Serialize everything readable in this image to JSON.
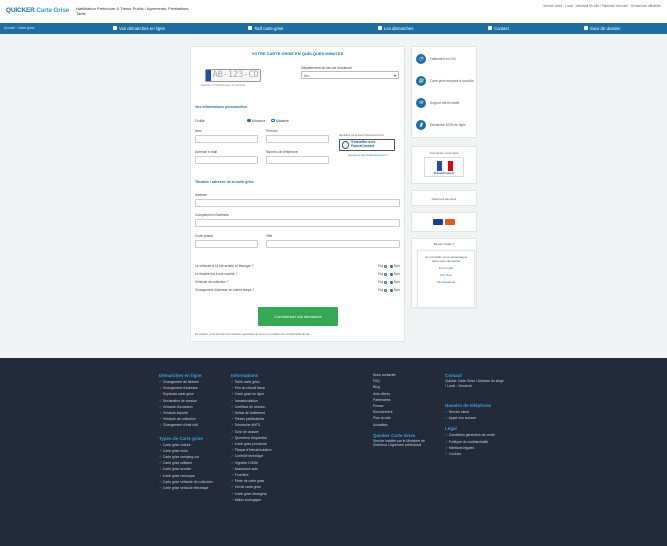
{
  "header": {
    "logo_main": "QUICKER",
    "logo_accent": "Carte Grise",
    "tagline": "Habilitation Préfecture & Trésor Public / Agréments, Prestations, Tarifs",
    "topright": "Service client · Lundi - Vendredi 9h-18h / Paiement sécurisé · Démarches officielles"
  },
  "nav": {
    "home": "Accueil · Carte grise",
    "items": [
      "Vos démarches en ligne",
      "Tarif carte grise",
      "Les démarches",
      "Contact",
      "Suivi de dossier"
    ]
  },
  "form": {
    "title": "VOTRE CARTE GRISE EN QUELQUES MINUTES",
    "plate_text": "AB-123-CD",
    "plate_hint": "Saisissez l'immatriculation du véhicule",
    "dept_label": "Département du lieu de résidence",
    "dept_value": "Ain",
    "section1": "Vos informations personnelles",
    "civility_label": "Civilité",
    "radio_options": [
      "Monsieur",
      "Madame"
    ],
    "nom_label": "Nom",
    "prenom_label": "Prénom",
    "email_label": "Adresse e-mail",
    "phone_label": "Numéro de téléphone",
    "fc_caption": "Identifiez-vous avec FranceConnect",
    "fc_button": "S'identifier avec FranceConnect",
    "fc_link": "Qu'est-ce que FranceConnect ?",
    "section2": "Titulaire / adresse de la carte grise",
    "adresse_label": "Adresse",
    "complement_label": "Complément d'adresse",
    "cp_label": "Code postal",
    "ville_label": "Ville",
    "questions": [
      "Le véhicule a-t-il été acheté à l'étranger ?",
      "Le titulaire est-il une société ?",
      "Véhicule de collection ?",
      "Changement d'adresse en même temps ?"
    ],
    "yes_label": "Oui",
    "no_label": "Non",
    "submit": "Commencer ma démarche",
    "legal": "En validant, vous acceptez les conditions générales de vente et la politique de confidentialité du site."
  },
  "sidebar": {
    "rows": [
      {
        "icon": "clock-icon",
        "glyph": "◷",
        "label": "Traitement en 24h"
      },
      {
        "icon": "document-icon",
        "glyph": "▤",
        "label": "Carte grise envoyée à domicile"
      },
      {
        "icon": "chat-icon",
        "glyph": "✉",
        "label": "Support client réactif"
      },
      {
        "icon": "bookmark-icon",
        "glyph": "▮",
        "label": "Démarche 100% en ligne"
      }
    ],
    "fc_title": "Connectez-vous avec",
    "fc_name": "FranceConnect",
    "secure_label": "Paiement sécurisé",
    "help_title": "Besoin d'aide ?",
    "help_text": "Un conseiller vous accompagne dans votre démarche",
    "help_options": [
      "Par e-mail",
      "Par chat",
      "Par téléphone"
    ]
  },
  "footer": {
    "col1_title": "Démarches en ligne",
    "col1_items": [
      "Changement de titulaire",
      "Changement d'adresse",
      "Duplicata carte grise",
      "Déclaration de cession",
      "Véhicule d'occasion",
      "Véhicule importé",
      "Véhicule de collection",
      "Changement d'état civil"
    ],
    "col1b_title": "Types de Carte grise",
    "col1b_items": [
      "Carte grise voiture",
      "Carte grise moto",
      "Carte grise camping-car",
      "Carte grise utilitaire",
      "Carte grise scooter",
      "Carte grise remorque",
      "Carte grise véhicule de collection",
      "Carte grise véhicule électrique"
    ],
    "col2_title": "Informations",
    "col2_items": [
      "Tarifs carte grise",
      "Prix du cheval fiscal",
      "Carte grise en ligne",
      "Immatriculation",
      "Certificat de cession",
      "Délais de traitement",
      "Pièces justificatives",
      "Démarche ANTS",
      "Suivi de dossier",
      "Questions fréquentes",
      "Carte grise provisoire",
      "Plaque d'immatriculation",
      "Contrôle technique",
      "Vignette Crit'Air",
      "Assurance auto",
      "Fourrière",
      "Perte de carte grise",
      "Vol de carte grise",
      "Carte grise étrangère",
      "Malus écologique"
    ],
    "col3_items": [
      "Nous contacter",
      "FAQ",
      "Blog",
      "Avis clients",
      "Partenaires",
      "Presse",
      "Recrutement",
      "Plan du site",
      "Actualités"
    ],
    "col3b_title": "Quicker Carte Grise",
    "col3b_text": "Service habilité par le Ministère de l'Intérieur / Agrément préfectoral",
    "col4_title": "Contact",
    "col4_text": "Quicker Carte Grise / Adresse du siège / Lundi - Vendredi",
    "col4b_title": "Numéro de téléphone",
    "col4b_items": [
      "Service client",
      "Appel non surtaxé"
    ],
    "col4c_title": "Légal",
    "col4c_items": [
      "Conditions générales de vente",
      "Politique de confidentialité",
      "Mentions légales",
      "Cookies"
    ]
  },
  "colors": {
    "brand": "#1f6ea3",
    "accent": "#3aa0d8",
    "cta": "#36a853",
    "footer": "#232b3b"
  }
}
